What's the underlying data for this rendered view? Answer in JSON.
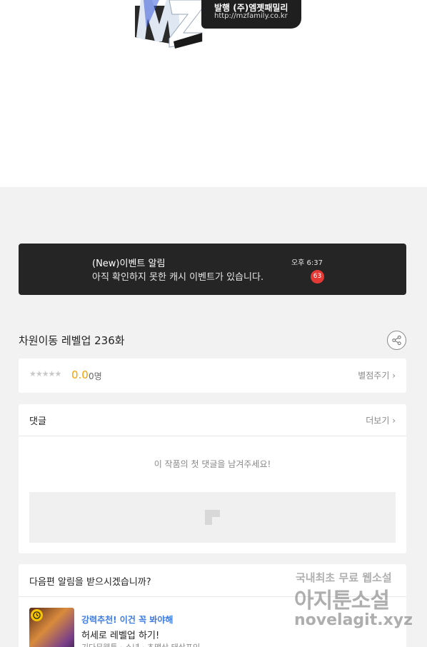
{
  "publisher": {
    "name": "발행 (주)엠젯패밀리",
    "url": "http://mzfamily.co.kr"
  },
  "notification": {
    "title": "(New)이벤트 알림",
    "message": "아직 확인하지 못한 캐시 이벤트가 있습니다.",
    "time": "오후 6:37",
    "badge_count": "63"
  },
  "episode": {
    "title": "차원이동 레벨업 236화"
  },
  "rating": {
    "stars": "★★★★★",
    "score": "0.0",
    "count": "0명",
    "rate_label": "별점주기 ›"
  },
  "comments": {
    "title": "댓글",
    "more_label": "더보기 ›",
    "empty_message": "이 작품의 첫 댓글을 남겨주세요!"
  },
  "next_episode": {
    "question": "다음편 알림을 받으시겠습니까?",
    "recommendation": {
      "label": "강력추천! 이건 꼭 봐야해",
      "title": "허세로 레벨업 하기!",
      "meta": "기다무웹툰 · 소년 · 초맥삭 태상프인"
    }
  },
  "watermark": {
    "line1": "국내최초 무료 웹소설",
    "line2": "아지툰소설",
    "line3": "novelagit.xyz"
  },
  "colors": {
    "notification_bg": "#252525",
    "badge": "#e53935",
    "rating": "#f5a000",
    "recommend": "#3d7be0",
    "page_bg": "#f2f2f2"
  }
}
